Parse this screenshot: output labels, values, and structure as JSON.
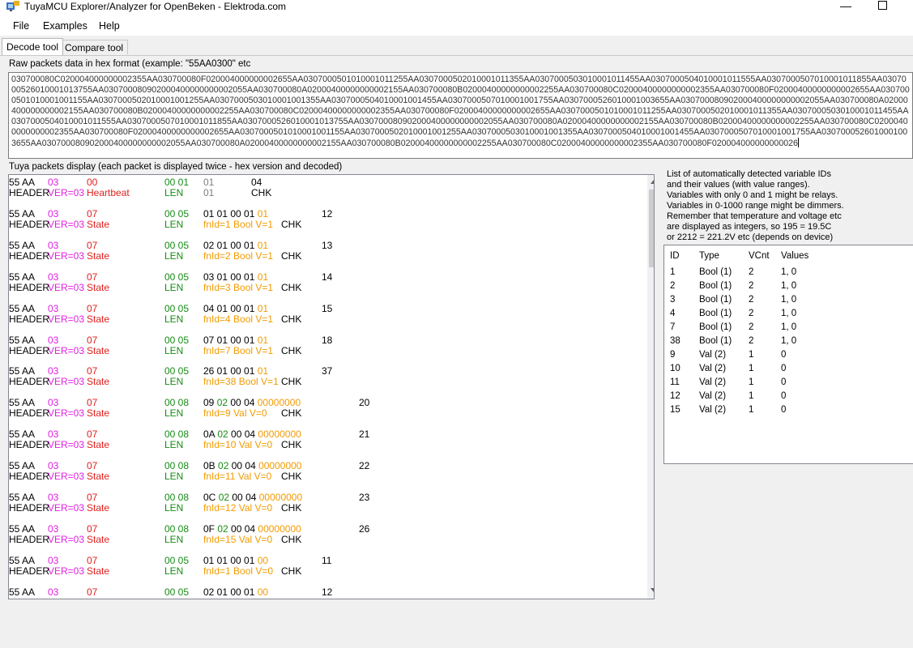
{
  "window": {
    "title": "TuyaMCU Explorer/Analyzer for OpenBeken - Elektroda.com",
    "minimize": "—"
  },
  "menu": [
    "File",
    "Examples",
    "Help"
  ],
  "tabs": [
    "Decode tool",
    "Compare tool"
  ],
  "raw": {
    "label": "Raw packets data in hex format (example: \"55AA0300\" etc",
    "value": "030700080C020004000000002355AA030700080F020004000000002655AA0307000501010001011255AA0307000502010001011355AA0307000503010001011455AA0307000504010001011555AA0307000507010001011855AA0307000526010001013755AA030700080902000400000000002055AA030700080A02000400000000002155AA030700080B02000400000000002255AA030700080C02000400000000002355AA030700080F02000400000000002655AA0307000501010001001155AA0307000502010001001255AA0307000503010001001355AA0307000504010001001455AA0307000507010001001755AA0307000526010001003655AA030700080902000400000000002055AA030700080A02000400000000002155AA030700080B02000400000000002255AA030700080C02000400000000002355AA030700080F02000400000000002655AA0307000501010001011255AA0307000502010001011355AA0307000503010001011455AA0307000504010001011555AA0307000507010001011855AA0307000526010001013755AA030700080902000400000000002055AA030700080A02000400000000002155AA030700080B02000400000000002255AA030700080C02000400000000002355AA030700080F02000400000000002655AA0307000501010001001155AA0307000502010001001255AA0307000503010001001355AA0307000504010001001455AA0307000507010001001755AA0307000526010001003655AA030700080902000400000000002055AA030700080A02000400000000002155AA030700080B02000400000000002255AA030700080C02000400000000002355AA030700080F020004000000000026"
  },
  "packets_label": "Tuya packets display (each packet is displayed twice - hex version and decoded)",
  "packets": [
    {
      "a": "55 AA",
      "b": "03",
      "c": "00",
      "d": "00 01",
      "e": [
        {
          "t": "01",
          "k": "gry"
        }
      ],
      "f": "04",
      "g": "HEADER",
      "h": "VER=03",
      "i": "Heartbeat",
      "j": "LEN",
      "l": [
        {
          "t": "01",
          "k": "gry"
        }
      ],
      "m": "CHK",
      "fx": 299,
      "mx": 299
    },
    {
      "a": "55 AA",
      "b": "03",
      "c": "07",
      "d": "00 05",
      "e": [
        {
          "t": "01 01 00 01 ",
          "k": "blk"
        },
        {
          "t": "01",
          "k": "org"
        }
      ],
      "f": "12",
      "g": "HEADER",
      "h": "VER=03",
      "i": "State",
      "j": "LEN",
      "l": [
        {
          "t": "fnId=1 Bool V=1",
          "k": "org"
        }
      ],
      "m": "CHK",
      "fx": 386,
      "mx": 336
    },
    {
      "a": "55 AA",
      "b": "03",
      "c": "07",
      "d": "00 05",
      "e": [
        {
          "t": "02 01 00 01 ",
          "k": "blk"
        },
        {
          "t": "01",
          "k": "org"
        }
      ],
      "f": "13",
      "g": "HEADER",
      "h": "VER=03",
      "i": "State",
      "j": "LEN",
      "l": [
        {
          "t": "fnId=2 Bool V=1",
          "k": "org"
        }
      ],
      "m": "CHK",
      "fx": 386,
      "mx": 336
    },
    {
      "a": "55 AA",
      "b": "03",
      "c": "07",
      "d": "00 05",
      "e": [
        {
          "t": "03 01 00 01 ",
          "k": "blk"
        },
        {
          "t": "01",
          "k": "org"
        }
      ],
      "f": "14",
      "g": "HEADER",
      "h": "VER=03",
      "i": "State",
      "j": "LEN",
      "l": [
        {
          "t": "fnId=3 Bool V=1",
          "k": "org"
        }
      ],
      "m": "CHK",
      "fx": 386,
      "mx": 336
    },
    {
      "a": "55 AA",
      "b": "03",
      "c": "07",
      "d": "00 05",
      "e": [
        {
          "t": "04 01 00 01 ",
          "k": "blk"
        },
        {
          "t": "01",
          "k": "org"
        }
      ],
      "f": "15",
      "g": "HEADER",
      "h": "VER=03",
      "i": "State",
      "j": "LEN",
      "l": [
        {
          "t": "fnId=4 Bool V=1",
          "k": "org"
        }
      ],
      "m": "CHK",
      "fx": 386,
      "mx": 336
    },
    {
      "a": "55 AA",
      "b": "03",
      "c": "07",
      "d": "00 05",
      "e": [
        {
          "t": "07 01 00 01 ",
          "k": "blk"
        },
        {
          "t": "01",
          "k": "org"
        }
      ],
      "f": "18",
      "g": "HEADER",
      "h": "VER=03",
      "i": "State",
      "j": "LEN",
      "l": [
        {
          "t": "fnId=7 Bool V=1",
          "k": "org"
        }
      ],
      "m": "CHK",
      "fx": 386,
      "mx": 336
    },
    {
      "a": "55 AA",
      "b": "03",
      "c": "07",
      "d": "00 05",
      "e": [
        {
          "t": "26 01 00 01 ",
          "k": "blk"
        },
        {
          "t": "01",
          "k": "org"
        }
      ],
      "f": "37",
      "g": "HEADER",
      "h": "VER=03",
      "i": "State",
      "j": "LEN",
      "l": [
        {
          "t": "fnId=38 Bool V=1",
          "k": "org"
        }
      ],
      "m": "CHK",
      "fx": 386,
      "mx": 336
    },
    {
      "a": "55 AA",
      "b": "03",
      "c": "07",
      "d": "00 08",
      "e": [
        {
          "t": "09 ",
          "k": "blk"
        },
        {
          "t": "02",
          "k": "grn"
        },
        {
          "t": " 00 04 ",
          "k": "blk"
        },
        {
          "t": "00000000",
          "k": "org"
        }
      ],
      "f": "20",
      "g": "HEADER",
      "h": "VER=03",
      "i": "State",
      "j": "LEN",
      "l": [
        {
          "t": "fnId=9 Val V=0",
          "k": "org"
        }
      ],
      "m": "CHK",
      "fx": 432,
      "mx": 336
    },
    {
      "a": "55 AA",
      "b": "03",
      "c": "07",
      "d": "00 08",
      "e": [
        {
          "t": "0A ",
          "k": "blk"
        },
        {
          "t": "02",
          "k": "grn"
        },
        {
          "t": " 00 04 ",
          "k": "blk"
        },
        {
          "t": "00000000",
          "k": "org"
        }
      ],
      "f": "21",
      "g": "HEADER",
      "h": "VER=03",
      "i": "State",
      "j": "LEN",
      "l": [
        {
          "t": "fnId=10 Val V=0",
          "k": "org"
        }
      ],
      "m": "CHK",
      "fx": 432,
      "mx": 336
    },
    {
      "a": "55 AA",
      "b": "03",
      "c": "07",
      "d": "00 08",
      "e": [
        {
          "t": "0B ",
          "k": "blk"
        },
        {
          "t": "02",
          "k": "grn"
        },
        {
          "t": " 00 04 ",
          "k": "blk"
        },
        {
          "t": "00000000",
          "k": "org"
        }
      ],
      "f": "22",
      "g": "HEADER",
      "h": "VER=03",
      "i": "State",
      "j": "LEN",
      "l": [
        {
          "t": "fnId=11 Val V=0",
          "k": "org"
        }
      ],
      "m": "CHK",
      "fx": 432,
      "mx": 336
    },
    {
      "a": "55 AA",
      "b": "03",
      "c": "07",
      "d": "00 08",
      "e": [
        {
          "t": "0C ",
          "k": "blk"
        },
        {
          "t": "02",
          "k": "grn"
        },
        {
          "t": " 00 04 ",
          "k": "blk"
        },
        {
          "t": "00000000",
          "k": "org"
        }
      ],
      "f": "23",
      "g": "HEADER",
      "h": "VER=03",
      "i": "State",
      "j": "LEN",
      "l": [
        {
          "t": "fnId=12 Val V=0",
          "k": "org"
        }
      ],
      "m": "CHK",
      "fx": 432,
      "mx": 336
    },
    {
      "a": "55 AA",
      "b": "03",
      "c": "07",
      "d": "00 08",
      "e": [
        {
          "t": "0F ",
          "k": "blk"
        },
        {
          "t": "02",
          "k": "grn"
        },
        {
          "t": " 00 04 ",
          "k": "blk"
        },
        {
          "t": "00000000",
          "k": "org"
        }
      ],
      "f": "26",
      "g": "HEADER",
      "h": "VER=03",
      "i": "State",
      "j": "LEN",
      "l": [
        {
          "t": "fnId=15 Val V=0",
          "k": "org"
        }
      ],
      "m": "CHK",
      "fx": 432,
      "mx": 336
    },
    {
      "a": "55 AA",
      "b": "03",
      "c": "07",
      "d": "00 05",
      "e": [
        {
          "t": "01 01 00 01 ",
          "k": "blk"
        },
        {
          "t": "00",
          "k": "org"
        }
      ],
      "f": "11",
      "g": "HEADER",
      "h": "VER=03",
      "i": "State",
      "j": "LEN",
      "l": [
        {
          "t": "fnId=1 Bool V=0",
          "k": "org"
        }
      ],
      "m": "CHK",
      "fx": 386,
      "mx": 336
    },
    {
      "a": "55 AA",
      "b": "03",
      "c": "07",
      "d": "00 05",
      "e": [
        {
          "t": "02 01 00 01 ",
          "k": "blk"
        },
        {
          "t": "00",
          "k": "org"
        }
      ],
      "f": "12",
      "g": "",
      "h": "",
      "i": "",
      "j": "",
      "l": [],
      "m": "",
      "fx": 386,
      "mx": 336
    }
  ],
  "info": "List of automatically detected variable IDs\nand their values (with value ranges).\nVariables with only 0 and 1 might be relays.\nVariables in 0-1000 range might be dimmers.\nRemember that temperature and voltage etc\nare displayed as integers, so 195 = 19.5C\nor 2212 = 221.2V etc (depends on device)",
  "vars": {
    "headers": [
      "ID",
      "Type",
      "VCnt",
      "Values"
    ],
    "rows": [
      [
        "1",
        "Bool (1)",
        "2",
        "1, 0"
      ],
      [
        "2",
        "Bool (1)",
        "2",
        "1, 0"
      ],
      [
        "3",
        "Bool (1)",
        "2",
        "1, 0"
      ],
      [
        "4",
        "Bool (1)",
        "2",
        "1, 0"
      ],
      [
        "7",
        "Bool (1)",
        "2",
        "1, 0"
      ],
      [
        "38",
        "Bool (1)",
        "2",
        "1, 0"
      ],
      [
        "9",
        "Val (2)",
        "1",
        "0"
      ],
      [
        "10",
        "Val (2)",
        "1",
        "0"
      ],
      [
        "11",
        "Val (2)",
        "1",
        "0"
      ],
      [
        "12",
        "Val (2)",
        "1",
        "0"
      ],
      [
        "15",
        "Val (2)",
        "1",
        "0"
      ]
    ]
  },
  "colors": {
    "magenta": "#e020e0",
    "red": "#e0201e",
    "green": "#168c16",
    "orange": "#f29b00",
    "gray": "#808080"
  },
  "icons": {
    "app": "app-icon",
    "minimize": "minimize-icon",
    "maximize": "maximize-icon",
    "scroll_up": "scroll-up-arrow-icon",
    "scroll_down": "scroll-down-arrow-icon"
  }
}
